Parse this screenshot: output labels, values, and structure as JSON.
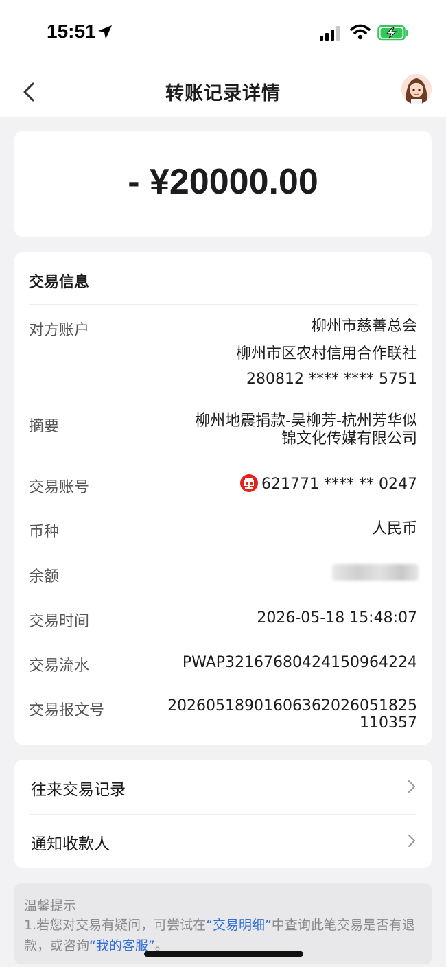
{
  "status_bar": {
    "time": "15:51"
  },
  "nav": {
    "title": "转账记录详情"
  },
  "amount": "- ¥20000.00",
  "transaction_info": {
    "section_title": "交易信息",
    "counterparty": {
      "label": "对方账户",
      "name": "柳州市慈善总会",
      "bank": "柳州市区农村信用合作联社",
      "account": "280812 **** **** 5751"
    },
    "memo": {
      "label": "摘要",
      "line1": "柳州地震捐款-吴柳芳-杭州芳华似",
      "line2": "锦文化传媒有限公司"
    },
    "account_no": {
      "label": "交易账号",
      "value": "621771 **** ** 0247"
    },
    "currency": {
      "label": "币种",
      "value": "人民币"
    },
    "balance": {
      "label": "余额",
      "value_hidden": true
    },
    "time": {
      "label": "交易时间",
      "value": "2026-05-18 15:48:07"
    },
    "serial": {
      "label": "交易流水",
      "value": "PWAP32167680424150964224"
    },
    "message_no": {
      "label": "交易报文号",
      "line1": "2026051890160636202605182​5",
      "line2": "110357"
    }
  },
  "links": {
    "history": "往来交易记录",
    "notify_payee": "通知收款人"
  },
  "tips": {
    "title": "温馨提示",
    "part1": "1.若您对交易有疑问，可尝试在",
    "link1": "“交易明细”",
    "part2": "中查询此笔交易是否有退款，或咨询",
    "link2": "“我的客服”",
    "part3": "。"
  },
  "colors": {
    "accent_link": "#2f6fd6",
    "bank_logo": "#e2231a",
    "battery": "#34c759"
  }
}
